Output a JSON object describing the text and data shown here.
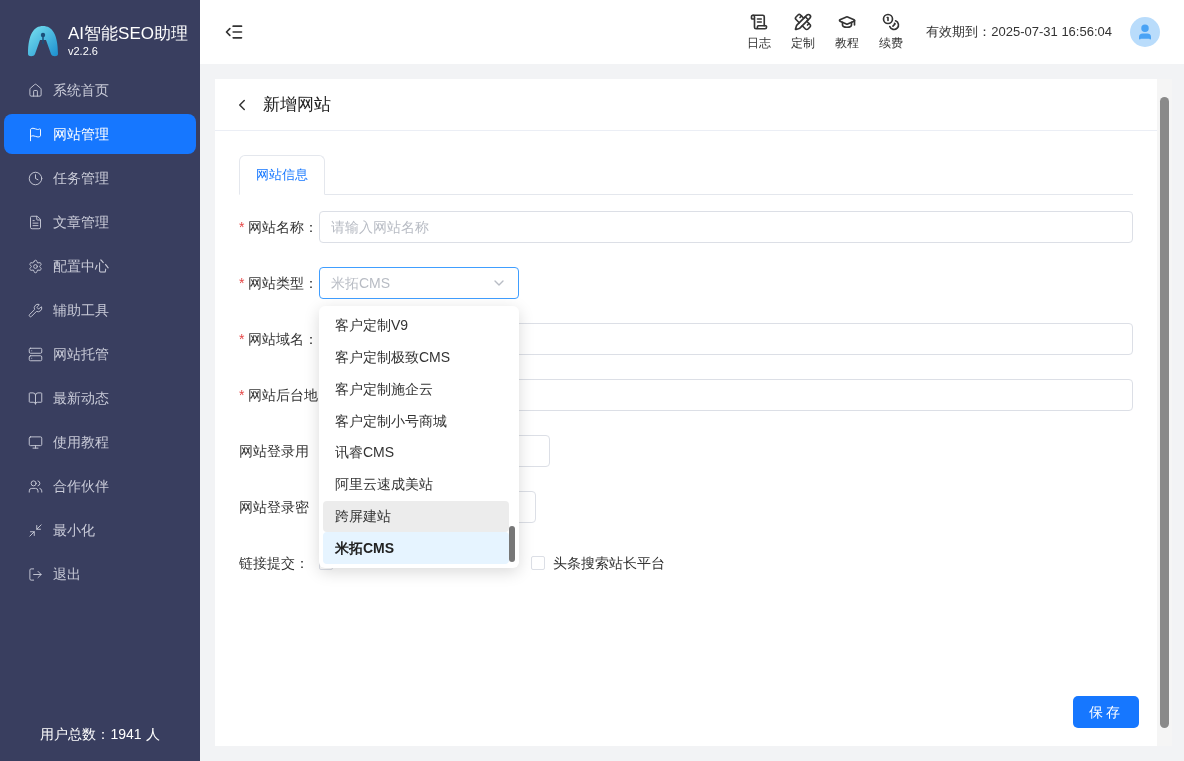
{
  "app": {
    "name": "AI智能SEO助理",
    "version": "v2.2.6"
  },
  "sidebar": {
    "items": [
      {
        "label": "系统首页",
        "selected": false
      },
      {
        "label": "网站管理",
        "selected": true
      },
      {
        "label": "任务管理",
        "selected": false
      },
      {
        "label": "文章管理",
        "selected": false
      },
      {
        "label": "配置中心",
        "selected": false
      },
      {
        "label": "辅助工具",
        "selected": false
      },
      {
        "label": "网站托管",
        "selected": false
      },
      {
        "label": "最新动态",
        "selected": false
      },
      {
        "label": "使用教程",
        "selected": false
      },
      {
        "label": "合作伙伴",
        "selected": false
      },
      {
        "label": "最小化",
        "selected": false
      },
      {
        "label": "退出",
        "selected": false
      }
    ],
    "footer": "用户总数：1941 人"
  },
  "header": {
    "tools": [
      {
        "label": "日志"
      },
      {
        "label": "定制"
      },
      {
        "label": "教程"
      },
      {
        "label": "续费"
      }
    ],
    "expiry": "有效期到：2025-07-31 16:56:04"
  },
  "page": {
    "title": "新增网站",
    "tabs": [
      {
        "label": "网站信息",
        "selected": true
      }
    ],
    "form": [
      {
        "kind": "text",
        "marker": "*",
        "label": "网站名称：",
        "placeholder": "请输入网站名称"
      },
      {
        "kind": "select",
        "marker": "*",
        "label": "网站类型：",
        "placeholder": "米拓CMS"
      },
      {
        "kind": "text",
        "marker": "*",
        "label": "网站域名："
      },
      {
        "kind": "text",
        "marker": "*",
        "label": "网站后台地"
      },
      {
        "kind": "text",
        "label": "网站登录用"
      },
      {
        "kind": "text",
        "label": "网站登录密"
      },
      {
        "kind": "checks",
        "label": "链接提交：",
        "options": [
          {
            "checked": false
          },
          {
            "label": "头条搜索站长平台",
            "checked": false
          }
        ]
      }
    ],
    "dropdown": [
      {
        "label": "客户定制V9",
        "selected": false,
        "hovered": false
      },
      {
        "label": "客户定制极致CMS",
        "selected": false,
        "hovered": false
      },
      {
        "label": "客户定制施企云",
        "selected": false,
        "hovered": false
      },
      {
        "label": "客户定制小号商城",
        "selected": false,
        "hovered": false
      },
      {
        "label": "讯睿CMS",
        "selected": false,
        "hovered": false
      },
      {
        "label": "阿里云速成美站",
        "selected": false,
        "hovered": false
      },
      {
        "label": "跨屏建站",
        "selected": false,
        "hovered": true
      },
      {
        "label": "米拓CMS",
        "selected": true,
        "hovered": false
      }
    ],
    "save": "保存"
  }
}
